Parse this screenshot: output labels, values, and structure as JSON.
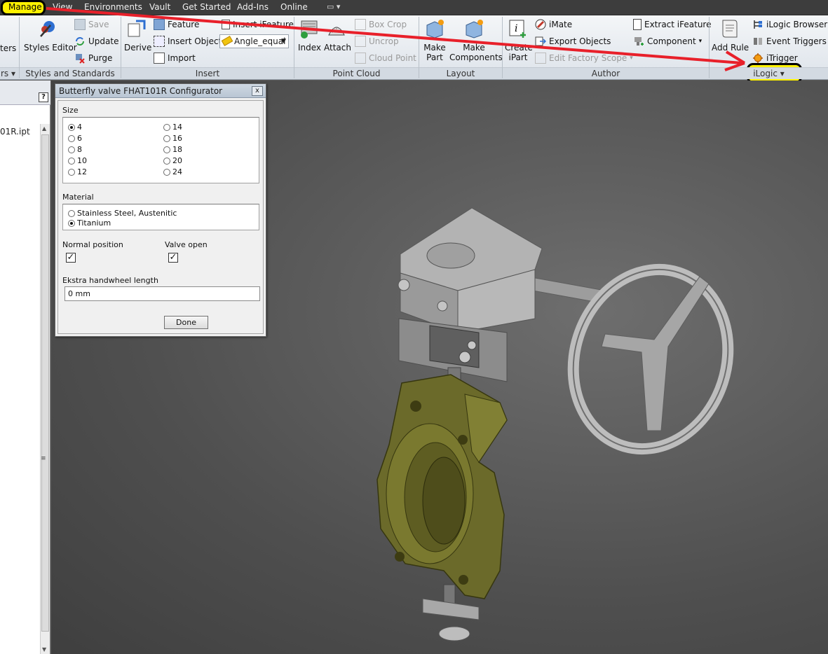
{
  "menubar": {
    "items": [
      "Manage",
      "View",
      "Environments",
      "Vault",
      "Get Started",
      "Add-Ins",
      "Online"
    ]
  },
  "ribbon": {
    "panels": {
      "styles": {
        "title": "Styles and Standards",
        "styles_editor": "Styles Editor",
        "save": "Save",
        "update": "Update",
        "purge": "Purge",
        "left_cut_title": "rs",
        "left_cut_label": "ters"
      },
      "insert": {
        "title": "Insert",
        "derive": "Derive",
        "feature": "Feature",
        "insert_object": "Insert Object",
        "import": "Import",
        "insert_ifeature": "Insert iFeature",
        "angle_select": "Angle_equal"
      },
      "point_cloud": {
        "title": "Point Cloud",
        "index": "Index",
        "attach": "Attach",
        "box_crop": "Box Crop",
        "uncrop": "Uncrop",
        "cloud_point": "Cloud Point"
      },
      "layout": {
        "title": "Layout",
        "make_part": "Make Part",
        "make_components": "Make Components"
      },
      "author": {
        "title": "Author",
        "create_ipart": "Create iPart",
        "imate": "iMate",
        "export_objects": "Export Objects",
        "edit_factory_scope": "Edit Factory Scope",
        "extract_ifeature": "Extract iFeature",
        "component": "Component"
      },
      "ilogic": {
        "title": "iLogic",
        "add_rule": "Add Rule",
        "ilogic_browser": "iLogic Browser",
        "event_triggers": "Event Triggers",
        "itrigger": "iTrigger"
      }
    }
  },
  "browser": {
    "file_row": "01R.ipt",
    "help": "?"
  },
  "dialog": {
    "title": "Butterfly valve FHAT101R Configurator",
    "close": "x",
    "size_label": "Size",
    "size_options": [
      "4",
      "6",
      "8",
      "10",
      "12",
      "14",
      "16",
      "18",
      "20",
      "24"
    ],
    "size_selected": "4",
    "material_label": "Material",
    "material_options": [
      "Stainless Steel, Austenitic",
      "Titanium"
    ],
    "material_selected": "Titanium",
    "normal_position_label": "Normal position",
    "normal_position_checked": true,
    "valve_open_label": "Valve open",
    "valve_open_checked": true,
    "handwheel_label": "Ekstra handwheel length",
    "handwheel_value": "0 mm",
    "done_label": "Done"
  },
  "colors": {
    "highlight": "#fff200",
    "annotation_arrow": "#e8202a",
    "valve_body": "#6b6a2a",
    "actuator": "#a9a9a9"
  }
}
